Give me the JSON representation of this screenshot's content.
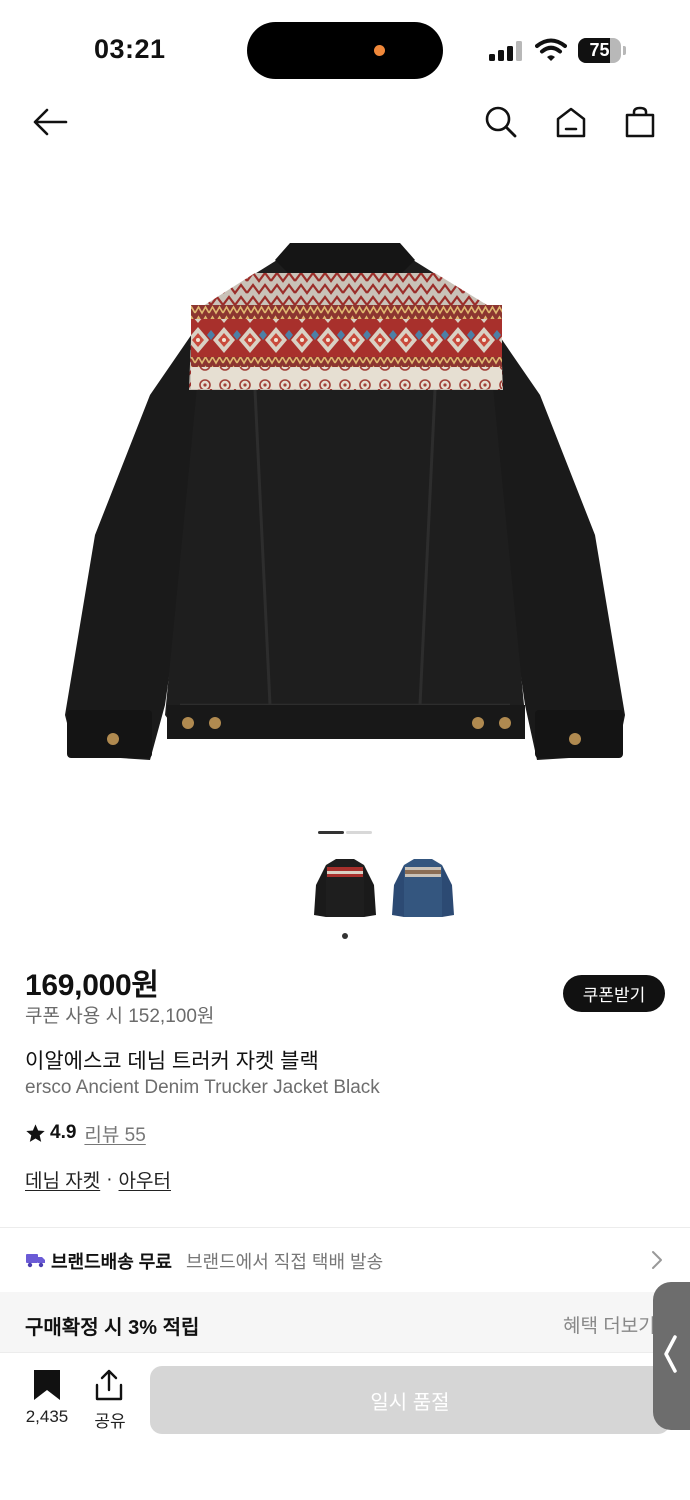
{
  "status_bar": {
    "time": "03:21",
    "battery_level": "75",
    "battery_fraction": 0.75
  },
  "nav": {
    "icons": [
      "back-arrow-icon",
      "search-icon",
      "home-icon",
      "shopping-bag-icon"
    ]
  },
  "gallery": {
    "current_page": 1,
    "total_pages": 2,
    "thumbnails": [
      "jacket-black-thumbnail",
      "jacket-blue-thumbnail"
    ]
  },
  "product": {
    "price": "169,000원",
    "coupon_price": "쿠폰 사용 시 152,100원",
    "coupon_button": "쿠폰받기",
    "name_ko": "이알에스코 데님 트러커 자켓 블랙",
    "name_en": "ersco Ancient Denim Trucker Jacket Black",
    "rating": "4.9",
    "review_link": "리뷰 55",
    "category_1": "데님 자켓",
    "category_sep": "·",
    "category_2": "아우터"
  },
  "delivery": {
    "title": "브랜드배송 무료",
    "desc": "브랜드에서 직접 택배 발송"
  },
  "points": {
    "title": "구매확정 시 3% 적립",
    "more": "혜택 더보기"
  },
  "bottom_bar": {
    "bookmark_count": "2,435",
    "share_label": "공유",
    "soldout_label": "일시 품절"
  },
  "colors": {
    "accent_truck": "#6b5bd6",
    "soldout_bg": "#d6d6d6",
    "coupon_bg": "#111111"
  }
}
